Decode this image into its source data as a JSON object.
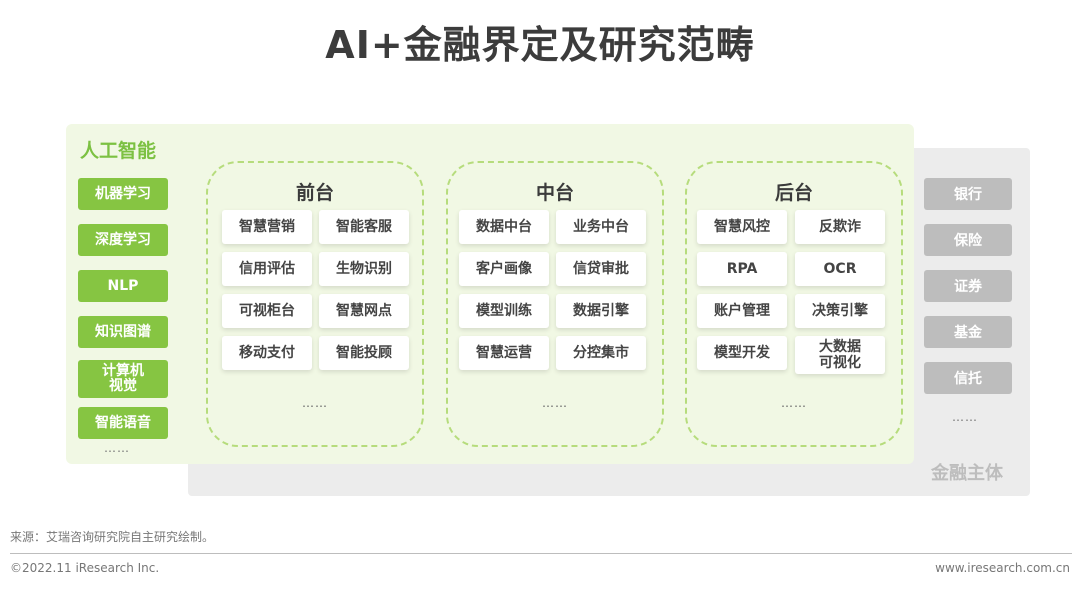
{
  "title": "AI+金融界定及研究范畴",
  "ai": {
    "title": "人工智能",
    "items": [
      "机器学习",
      "深度学习",
      "NLP",
      "知识图谱",
      "计算机\n视觉",
      "智能语音"
    ],
    "more": "……"
  },
  "platforms": [
    {
      "title": "前台",
      "chips": [
        "智慧营销",
        "智能客服",
        "信用评估",
        "生物识别",
        "可视柜台",
        "智慧网点",
        "移动支付",
        "智能投顾"
      ],
      "more": "……"
    },
    {
      "title": "中台",
      "chips": [
        "数据中台",
        "业务中台",
        "客户画像",
        "信贷审批",
        "模型训练",
        "数据引擎",
        "智慧运营",
        "分控集市"
      ],
      "more": "……"
    },
    {
      "title": "后台",
      "chips": [
        "智慧风控",
        "反欺诈",
        "RPA",
        "OCR",
        "账户管理",
        "决策引擎",
        "模型开发",
        "大数据\n可视化"
      ],
      "more": "……"
    }
  ],
  "finance": {
    "title": "金融主体",
    "items": [
      "银行",
      "保险",
      "证券",
      "基金",
      "信托"
    ],
    "more": "……"
  },
  "footer": {
    "source": "来源：艾瑞咨询研究院自主研究绘制。",
    "copyright": "©2022.11 iResearch Inc.",
    "website": "www.iresearch.com.cn"
  },
  "colors": {
    "ai_green": "#86c542",
    "panel_green": "#f1f8e4",
    "dash_green": "#b6dc7c",
    "finance_grey": "#bdbdbd"
  }
}
